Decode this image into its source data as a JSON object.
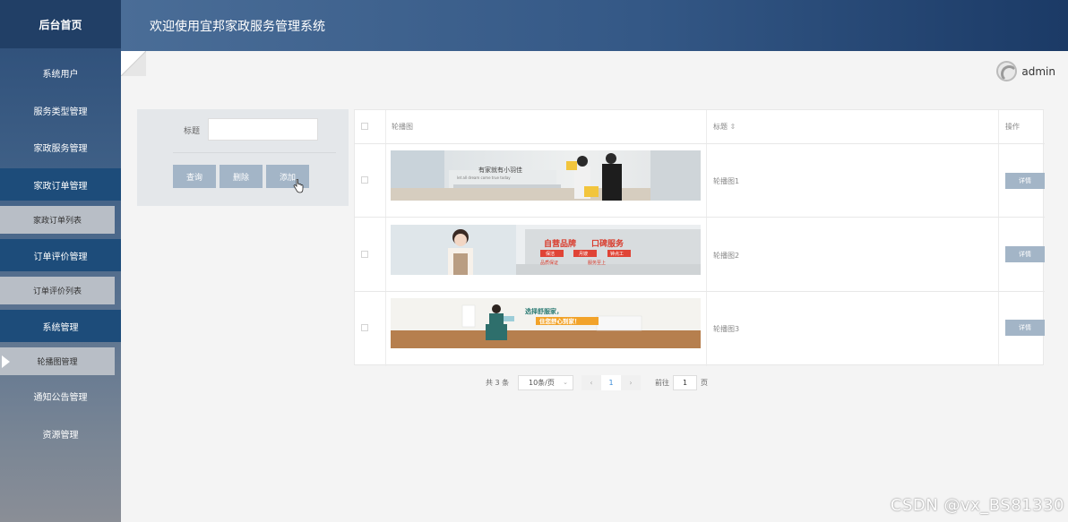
{
  "app": {
    "sidebar_title": "后台首页",
    "header_title": "欢迎使用宜邦家政服务管理系统",
    "user_name": "admin"
  },
  "sidebar": {
    "items": [
      {
        "label": "系统用户",
        "type": "menu"
      },
      {
        "label": "服务类型管理",
        "type": "menu"
      },
      {
        "label": "家政服务管理",
        "type": "menu"
      },
      {
        "label": "家政订单管理",
        "type": "menu",
        "active": true
      },
      {
        "label": "家政订单列表",
        "type": "sub"
      },
      {
        "label": "订单评价管理",
        "type": "menu",
        "active": true
      },
      {
        "label": "订单评价列表",
        "type": "sub"
      },
      {
        "label": "系统管理",
        "type": "menu",
        "active": true
      },
      {
        "label": "轮播图管理",
        "type": "sub",
        "current": true
      },
      {
        "label": "通知公告管理",
        "type": "menu"
      },
      {
        "label": "资源管理",
        "type": "menu"
      }
    ]
  },
  "search": {
    "title_label": "标题",
    "title_value": "",
    "query_button": "查询",
    "delete_button": "删除",
    "add_button": "添加"
  },
  "table": {
    "headers": {
      "image": "轮播图",
      "title": "标题",
      "sort_icon": "⇕",
      "action": "操作"
    },
    "rows": [
      {
        "title": "轮播图1",
        "action": "详情",
        "banner_text": [
          "有家就有小羽佳",
          "let all dream come true today"
        ]
      },
      {
        "title": "轮播图2",
        "action": "详情",
        "banner_text": [
          "自营品牌",
          "口碑服务",
          "保洁",
          "月嫂",
          "钟点工",
          "品质保证",
          "服务至上"
        ]
      },
      {
        "title": "轮播图3",
        "action": "详情",
        "banner_text": [
          "选择舒服家，",
          "住您舒心到家！"
        ]
      }
    ]
  },
  "pagination": {
    "total": "共 3 条",
    "page_size": "10条/页",
    "prev": "‹",
    "current_page": "1",
    "next": "›",
    "goto_label": "前往",
    "goto_value": "1",
    "page_unit": "页"
  },
  "watermark": "CSDN @vx_BS81330",
  "colors": {
    "sidebar_top": "#2c4d78",
    "active_menu": "#1d4c7a",
    "button": "#a3b5c7",
    "header_end": "#1b3a66"
  }
}
